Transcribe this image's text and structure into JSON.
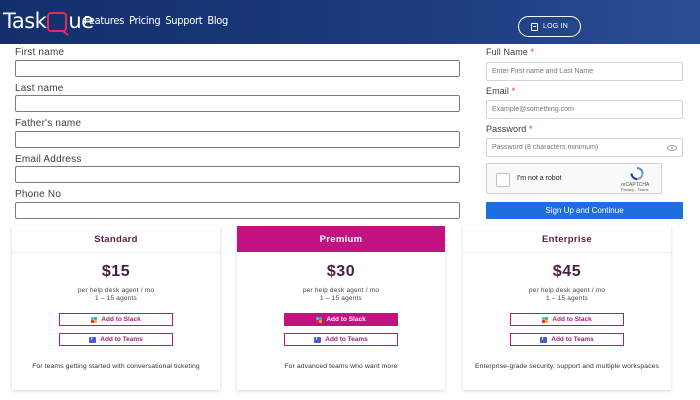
{
  "header": {
    "logo_text_1": "Task",
    "logo_text_2": "ue",
    "nav": [
      "Features",
      "Pricing",
      "Support",
      "Blog"
    ],
    "login_label": "LOG IN"
  },
  "form_left": {
    "first_name_label": "First name",
    "last_name_label": "Last name",
    "father_name_label": "Father's name",
    "email_label": "Email Address",
    "phone_label": "Phone No"
  },
  "form_right": {
    "full_name_label": "Full Name",
    "full_name_placeholder": "Enter First name and Last Name",
    "email_label": "Email",
    "email_placeholder": "Example@something.com",
    "password_label": "Password",
    "password_placeholder": "Password (8 characters minimum)",
    "required_marker": "*",
    "captcha_text": "I'm not a robot",
    "recaptcha_label": "reCAPTCHA",
    "recaptcha_links": "Privacy - Terms",
    "signup_label": "Sign Up and Continue"
  },
  "plans": [
    {
      "name": "Standard",
      "price": "$15",
      "per": "per help desk agent / mo",
      "agents": "1 – 15 agents",
      "slack_label": "Add to Slack",
      "teams_label": "Add to Teams",
      "description": "For teams getting started with conversational ticketing"
    },
    {
      "name": "Premium",
      "price": "$30",
      "per": "per help desk agent / mo",
      "agents": "1 – 15 agents",
      "slack_label": "Add to Slack",
      "teams_label": "Add to Teams",
      "description": "For advanced teams who want more"
    },
    {
      "name": "Enterprise",
      "price": "$45",
      "per": "per help desk agent / mo",
      "agents": "1 – 15 agents",
      "slack_label": "Add to Slack",
      "teams_label": "Add to Teams",
      "description": "Enterprise-grade security, support and multiple workspaces"
    }
  ],
  "colors": {
    "header_bg": "#1a3a7c",
    "brand_accent": "#c2127f",
    "signup_button": "#1d6fe0",
    "required": "#e02b2b"
  }
}
